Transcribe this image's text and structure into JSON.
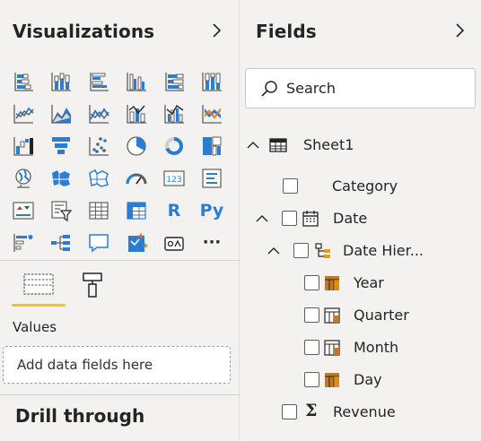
{
  "visualizations": {
    "title": "Visualizations",
    "chevron_icon": "chevron-right-icon",
    "gallery": [
      "stacked-bar-chart-icon",
      "stacked-column-chart-icon",
      "clustered-bar-chart-icon",
      "clustered-column-chart-icon",
      "100-percent-stacked-bar-chart-icon",
      "100-percent-stacked-column-chart-icon",
      "line-chart-icon",
      "area-chart-icon",
      "stacked-area-chart-icon",
      "line-and-stacked-column-chart-icon",
      "line-and-clustered-column-chart-icon",
      "ribbon-chart-icon",
      "waterfall-chart-icon",
      "funnel-chart-icon",
      "scatter-chart-icon",
      "pie-chart-icon",
      "donut-chart-icon",
      "treemap-icon",
      "map-icon",
      "filled-map-icon",
      "shape-map-icon",
      "gauge-icon",
      "card-icon",
      "multi-row-card-icon",
      "kpi-icon",
      "slicer-icon",
      "table-icon",
      "matrix-icon",
      "r-script-visual-icon",
      "python-visual-icon",
      "key-influencers-icon",
      "decomposition-tree-icon",
      "qa-icon",
      "smart-narrative-icon",
      "paginated-report-icon",
      "more-visuals-icon"
    ],
    "card_label": "123",
    "r_label": "R",
    "python_label": "Py",
    "more_label": "···",
    "tabs": [
      "fields-tab-icon",
      "format-tab-icon"
    ],
    "values_label": "Values",
    "dropzone_text": "Add data fields here",
    "drill_through_title": "Drill through"
  },
  "fields": {
    "title": "Fields",
    "chevron_icon": "chevron-right-icon",
    "search_placeholder": "Search",
    "tree": {
      "table_name": "Sheet1",
      "category": "Category",
      "date": "Date",
      "date_hierarchy": "Date Hier...",
      "year": "Year",
      "quarter": "Quarter",
      "month": "Month",
      "day": "Day",
      "revenue_symbol": "Σ",
      "revenue": "Revenue"
    }
  },
  "colors": {
    "pane_bg": "#f3f2f1",
    "accent_yellow": "#f2c811",
    "icon_blue": "#2b7cd3",
    "icon_orange": "#e8771a",
    "hierarchy_brown": "#c0792b"
  }
}
